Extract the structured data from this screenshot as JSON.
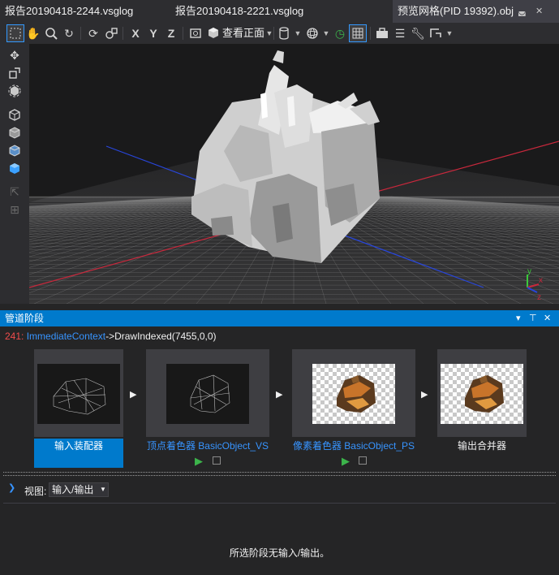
{
  "tabs": [
    {
      "label": "报告20190418-2244.vsglog"
    },
    {
      "label": "报告20190418-2221.vsglog"
    },
    {
      "label": "预览网格(PID 19392).obj",
      "pin_icon": "pin-icon",
      "close_icon": "close-icon"
    }
  ],
  "toolbar": {
    "view_label": "查看正面",
    "icons": [
      "select-rect-icon",
      "pan-hand-icon",
      "zoom-icon",
      "rotate-icon",
      "orbit-icon",
      "fly-icon",
      "x-axis-icon",
      "y-axis-icon",
      "z-axis-icon",
      "frame-icon",
      "cube-icon",
      "dropdown-icon",
      "cylinder-icon",
      "sphere-icon",
      "history-icon",
      "grid-icon",
      "toolbox-icon",
      "list-icon",
      "wrench-icon",
      "shape-icon"
    ],
    "axis_labels": [
      "X",
      "Y",
      "Z"
    ]
  },
  "viewport": {
    "axes_colors": {
      "x": "#c8283c",
      "y": "#3cc83c",
      "z": "#2846dc"
    },
    "gizmo_labels": [
      "y",
      "x",
      "z"
    ]
  },
  "pipeline": {
    "title": "管道阶段",
    "call": {
      "index": "241:",
      "context": "ImmediateContext",
      "rest": "->DrawIndexed(7455,0,0)"
    },
    "stages": [
      {
        "label": "输入装配器",
        "selected": true
      },
      {
        "label": "顶点着色器 BasicObject_VS",
        "link": true
      },
      {
        "label": "像素着色器 BasicObject_PS",
        "link": true
      },
      {
        "label": "输出合并器"
      }
    ],
    "view_label": "视图:",
    "view_value": "输入/输出",
    "empty_message": "所选阶段无输入/输出。"
  },
  "colors": {
    "accent": "#007acc",
    "link": "#3794ff",
    "error_red": "#f14c4c",
    "play_green": "#3cb44b"
  }
}
